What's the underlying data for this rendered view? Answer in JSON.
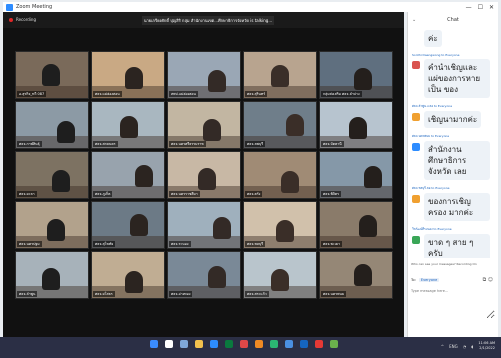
{
  "window": {
    "title": "Zoom Meeting",
    "controls": [
      "—",
      "☐",
      "✕"
    ]
  },
  "meeting": {
    "recording_label": "Recording",
    "banner": "นายเกรียงศักดิ์ ปุญสิริ กลุ่ม สำนักงานเขต...ศึกษาธิการจังหวัด is talking...",
    "tiles": [
      {
        "label": "อ.สุรกิจ_ทวี 087"
      },
      {
        "label": "ศธจ.แม่ฮ่องสอน"
      },
      {
        "label": "สพป.แม่ฮ่องสอน"
      },
      {
        "label": "ศธจ.สุรินทร์"
      },
      {
        "label": "กลุ่มส่งเสริม ศธจ.ลำปาง"
      },
      {
        "label": "ศธจ.กาฬสินธุ์"
      },
      {
        "label": "ศธจ.สกลนคร"
      },
      {
        "label": "ศธจ.นครศรีธรรมราช"
      },
      {
        "label": "ศธจ.ลพบุรี"
      },
      {
        "label": "ศธจ.ปัตตานี"
      },
      {
        "label": "ศธจ.ยะลา"
      },
      {
        "label": "ศธจ.ภูเก็ต"
      },
      {
        "label": "ศธจ.นครราชสีมา"
      },
      {
        "label": "ศธจ.ตรัง"
      },
      {
        "label": "ศธจ.พิจิตร"
      },
      {
        "label": "ศธจ.นครปฐม"
      },
      {
        "label": "ศธจ.สุโขทัย"
      },
      {
        "label": "ศธจ.ระนอง"
      },
      {
        "label": "ศธจ.ชลบุรี"
      },
      {
        "label": "ศธจ.พะเยา"
      },
      {
        "label": "ศธจ.ลำพูน"
      },
      {
        "label": "ศธจ.ยโสธร"
      },
      {
        "label": "ศธจ.อ่างทอง"
      },
      {
        "label": "ศธจ.สระแก้ว"
      },
      {
        "label": "ศธจ.นครพนม"
      }
    ]
  },
  "chat": {
    "title": "Chat",
    "messages": [
      {
        "from": "",
        "text": "ค่ะ",
        "color": "#ffffff"
      },
      {
        "from": "Sonthi Daengwong to Everyone",
        "text": "คำนำเชิญและ แผ่ของการหายเป็น ของ",
        "color": "#d9534f"
      },
      {
        "from": "ศธจ.ลำพูน.ง.ลอ to Everyone",
        "text": "เชิญนามากค่ะ",
        "color": "#f0a030"
      },
      {
        "from": "ศธจ.นครพนม to Everyone",
        "text": "สำนักงาน ศึกษาธิการจังหวัด เลย",
        "color": "#2d8cff"
      },
      {
        "from": "ศธจ.ชลบุรี.ลอ to Everyone",
        "text": "ของการเชิญครอง มากค่ะ",
        "color": "#f0a030"
      },
      {
        "from": "วีรภัฒน์ที่ระนอง to Everyone",
        "text": "ขาด ๆ สาย ๆ ครับ",
        "color": "#3aa657"
      }
    ],
    "hint": "Who can see your messages? Recording On",
    "to_label": "To:",
    "to_value": "Everyone",
    "placeholder": "Type message here..."
  },
  "taskbar": {
    "tray": "ENG",
    "time": "11:06 AM",
    "date": "2/1/2022"
  }
}
